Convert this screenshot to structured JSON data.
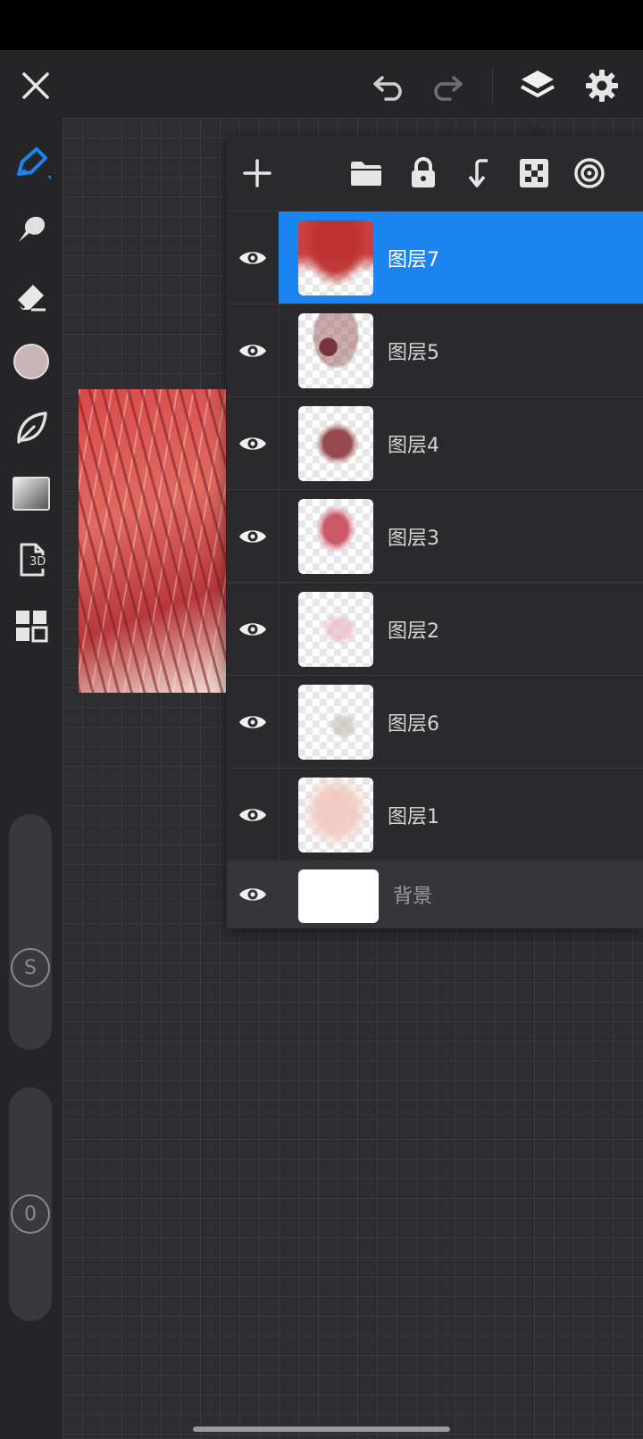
{
  "top_bar": {
    "close_icon": "close-icon",
    "undo_icon": "undo-icon",
    "redo_icon": "redo-icon",
    "layers_icon": "layers-icon",
    "settings_icon": "gear-icon"
  },
  "tools": [
    "brush-icon",
    "smudge-icon",
    "eraser-icon",
    "color-swatch",
    "leaf-icon",
    "gradient-icon",
    "3d-icon",
    "grid-icon"
  ],
  "tool_3d_label": "3D",
  "accent_color": "#1a84f0",
  "current_color": "#c9b5b7",
  "size_slider_label": "S",
  "opacity_slider_label": "0",
  "layers_panel": {
    "toolbar_icons": [
      "add-icon",
      "folder-icon",
      "lock-icon",
      "merge-down-icon",
      "transparency-icon",
      "target-icon"
    ],
    "layers": [
      {
        "name": "图层7",
        "selected": true
      },
      {
        "name": "图层5",
        "selected": false
      },
      {
        "name": "图层4",
        "selected": false
      },
      {
        "name": "图层3",
        "selected": false
      },
      {
        "name": "图层2",
        "selected": false
      },
      {
        "name": "图层6",
        "selected": false
      },
      {
        "name": "图层1",
        "selected": false
      }
    ],
    "background_layer": {
      "name": "背景"
    }
  }
}
